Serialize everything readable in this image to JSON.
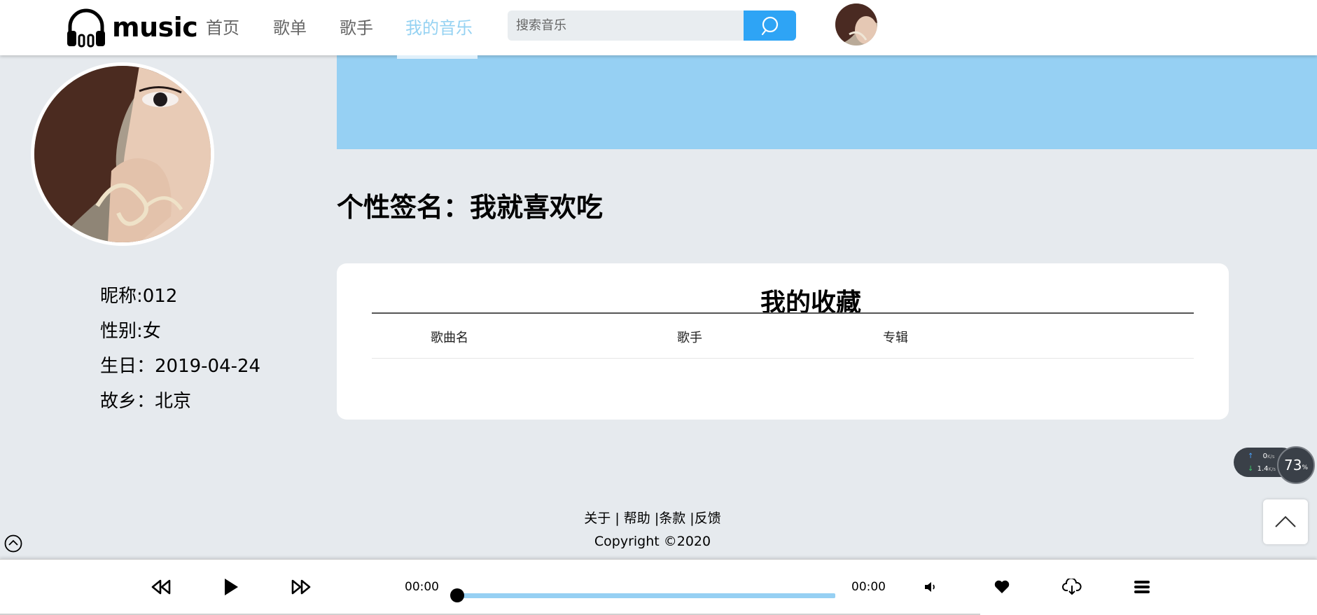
{
  "header": {
    "logo_text": "music",
    "nav": [
      "首页",
      "歌单",
      "歌手",
      "我的音乐"
    ],
    "active_nav": "我的音乐",
    "search_placeholder": "搜索音乐"
  },
  "profile": {
    "nickname": "昵称:012",
    "gender": "性别:女",
    "birthday": "生日：2019-04-24",
    "hometown": "故乡：北京"
  },
  "main": {
    "signature": "个性签名：我就喜欢吃",
    "favorites": {
      "title": "我的收藏",
      "columns": [
        "歌曲名",
        "歌手",
        "专辑"
      ]
    }
  },
  "footer": {
    "links": [
      "关于 |",
      "帮助 |",
      "条款 |",
      "反馈"
    ],
    "copyright": "Copyright ©2020"
  },
  "net_widget": {
    "upload_value": "0",
    "upload_unit": "K/s",
    "download_value": "1.4",
    "download_unit": "K/s",
    "percent": "73",
    "percent_unit": "%"
  },
  "player": {
    "current_time": "00:00",
    "total_time": "00:00",
    "progress": 0
  },
  "colors": {
    "accent": "#2ea4f5",
    "light_blue": "#96d0f3",
    "background": "#e6eaee"
  }
}
